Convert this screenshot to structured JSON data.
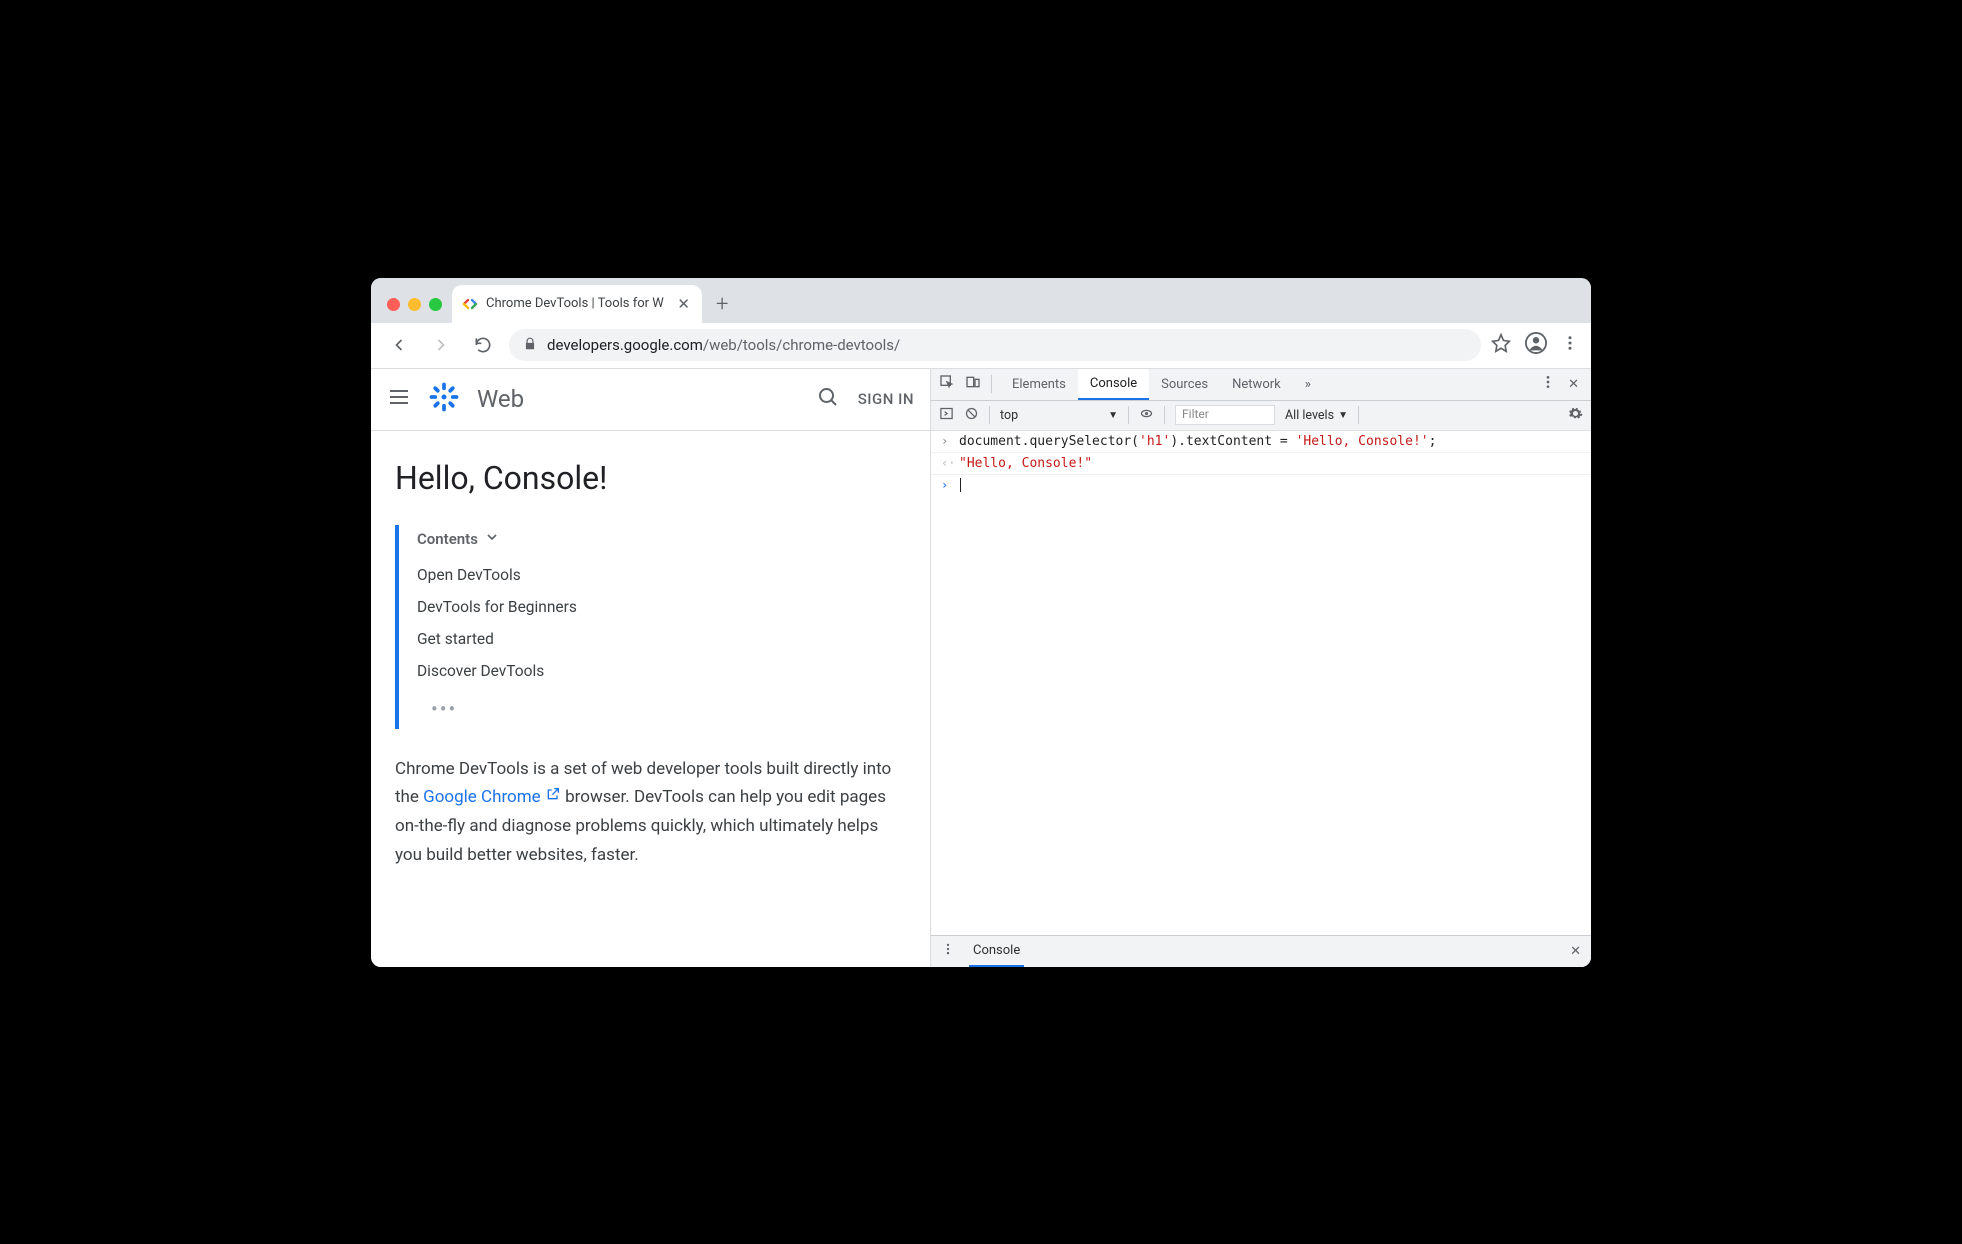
{
  "browser": {
    "tab_title": "Chrome DevTools  |  Tools for W",
    "url_domain": "developers.google.com",
    "url_path": "/web/tools/chrome-devtools/"
  },
  "page": {
    "brand": "Web",
    "signin": "SIGN IN",
    "h1": "Hello, Console!",
    "toc_label": "Contents",
    "toc_items": [
      "Open DevTools",
      "DevTools for Beginners",
      "Get started",
      "Discover DevTools"
    ],
    "para_before_link": "Chrome DevTools is a set of web developer tools built directly into the ",
    "link_text": "Google Chrome",
    "para_after_link": " browser. DevTools can help you edit pages on-the-fly and diagnose problems quickly, which ultimately helps you build better websites, faster."
  },
  "devtools": {
    "tabs": [
      "Elements",
      "Console",
      "Sources",
      "Network"
    ],
    "active_tab": "Console",
    "context": "top",
    "filter_placeholder": "Filter",
    "levels": "All levels",
    "drawer_tab": "Console",
    "input_code_plain": "document.querySelector(",
    "input_code_arg": "'h1'",
    "input_code_mid": ").textContent = ",
    "input_code_val": "'Hello, Console!'",
    "input_code_end": ";",
    "output_value": "\"Hello, Console!\""
  }
}
